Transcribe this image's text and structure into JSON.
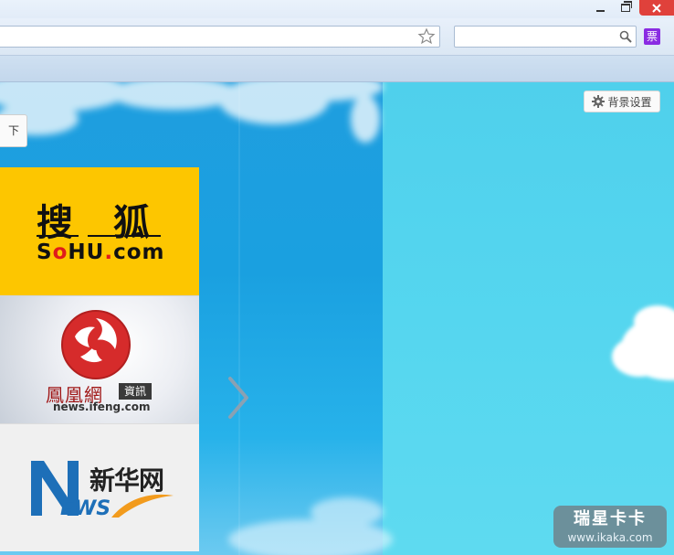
{
  "window": {
    "controls": {
      "minimize_icon": "minimize-icon",
      "maximize_icon": "restore-icon",
      "close_icon": "close-icon",
      "close_color": "#e0413b"
    }
  },
  "navbar": {
    "address": {
      "value": ""
    },
    "search": {
      "value": "",
      "placeholder": ""
    },
    "ticket_label": "票"
  },
  "content": {
    "background_settings_label": "背景设置",
    "dropdown_stub_label": "下",
    "tiles": {
      "sohu": {
        "name_cn": "搜狐",
        "domain_prefix": "S",
        "domain_o": "o",
        "domain_mid": "HU",
        "domain_dot": ".",
        "domain_suffix": "com",
        "bg_color": "#fdc600"
      },
      "ifeng": {
        "name_cn": "鳳凰網",
        "badge": "資訊",
        "url": "news.ifeng.com"
      },
      "xinhua": {
        "name_cn": "新华网",
        "news_suffix": "EWS"
      }
    },
    "next_icon": "chevron-right-icon"
  },
  "watermark": {
    "title": "瑞星卡卡",
    "url": "www.ikaka.com"
  }
}
